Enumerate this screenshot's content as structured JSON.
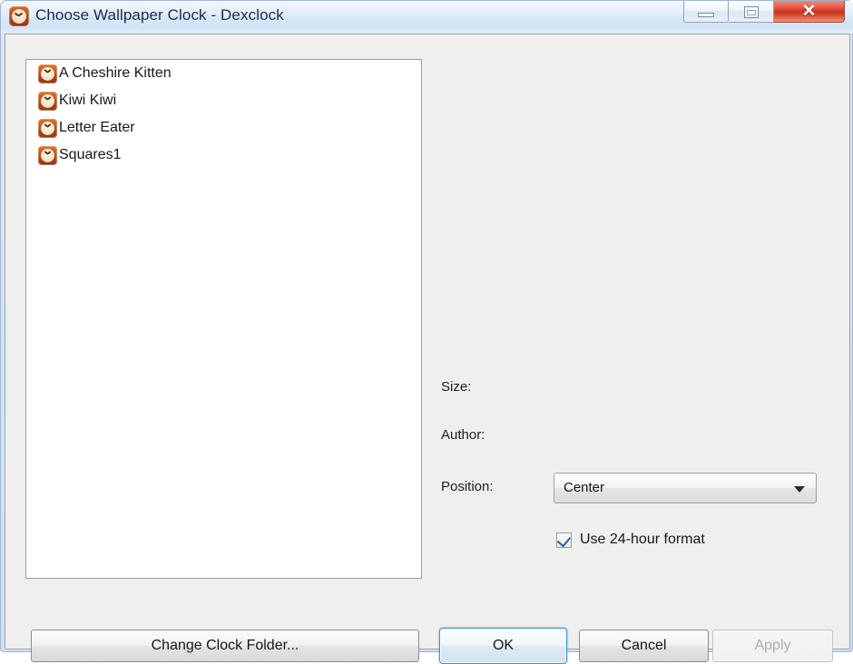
{
  "window": {
    "title": "Choose Wallpaper Clock - Dexclock",
    "icon": "clock-icon",
    "controls": {
      "minimize_label": "Minimize",
      "maximize_label": "Restore",
      "close_label": "✕"
    }
  },
  "list": {
    "items": [
      {
        "label": "A Cheshire Kitten",
        "icon": "clock-icon"
      },
      {
        "label": "Kiwi Kiwi",
        "icon": "clock-icon"
      },
      {
        "label": "Letter Eater",
        "icon": "clock-icon"
      },
      {
        "label": "Squares1",
        "icon": "clock-icon"
      }
    ]
  },
  "details": {
    "size_label": "Size:",
    "size_value": "",
    "author_label": "Author:",
    "author_value": "",
    "position_label": "Position:",
    "position_value": "Center",
    "position_options": [
      "Center"
    ],
    "use_24_hour_label": "Use 24-hour format",
    "use_24_hour_checked": true
  },
  "buttons": {
    "change_folder": "Change Clock Folder...",
    "ok": "OK",
    "cancel": "Cancel",
    "apply": "Apply",
    "apply_disabled": true
  },
  "colors": {
    "titlebar_text": "#10274a",
    "accent_focus": "#3c93cf",
    "close_red": "#c9301b",
    "icon_orange": "#bf4b1c",
    "disabled_text": "#adadad"
  }
}
